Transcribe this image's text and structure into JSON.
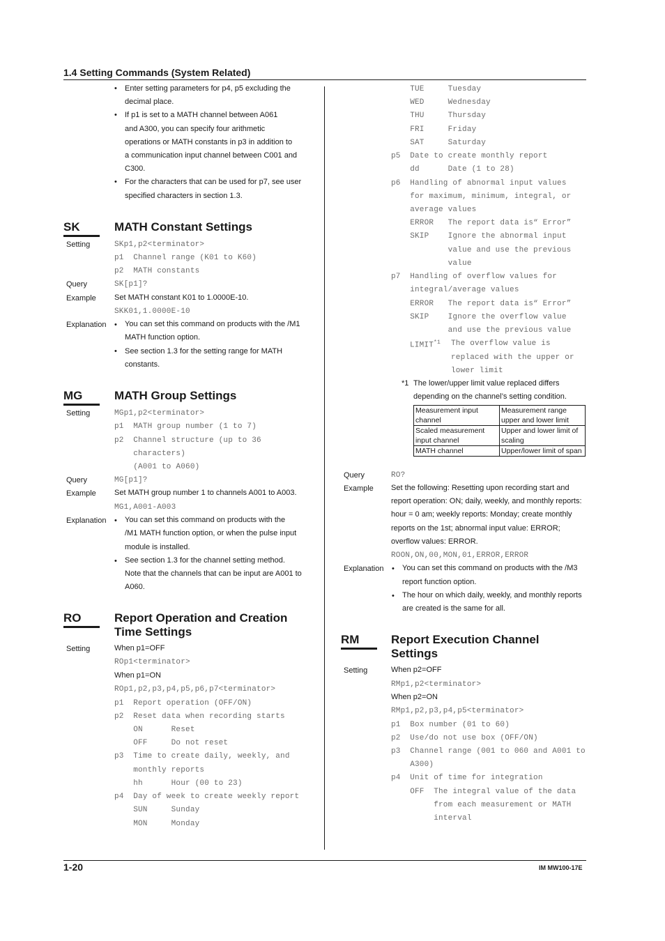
{
  "header": {
    "section": "1.4  Setting Commands (System Related)"
  },
  "footer": {
    "page": "1-20",
    "doc_id": "IM MW100-17E"
  },
  "intro_bullets": [
    [
      "Enter setting parameters for p4, p5 excluding the",
      "decimal place."
    ],
    [
      "If p1 is set to a MATH channel between A061",
      "and A300, you can specify four arithmetic",
      "operations or MATH constants in p3 in addition to",
      "a communication input channel between C001 and",
      "C300."
    ],
    [
      "For the characters that can be used for p7, see user",
      "specified characters in section 1.3."
    ]
  ],
  "labels": {
    "setting": "Setting",
    "query": "Query",
    "example": "Example",
    "explanation": "Explanation"
  },
  "sk": {
    "code": "SK",
    "title": "MATH Constant Settings",
    "setting": [
      "SKp1,p2<terminator>",
      "p1  Channel range (K01 to K60)",
      "p2  MATH constants"
    ],
    "query": "SK[p1]?",
    "example_text": "Set MATH constant K01 to 1.0000E-10.",
    "example_code": "SKK01,1.0000E-10",
    "explanation": [
      [
        "You can set this command on products with the /M1",
        "MATH function option."
      ],
      [
        "See section 1.3 for the setting range for MATH",
        "constants."
      ]
    ]
  },
  "mg": {
    "code": "MG",
    "title": "MATH Group Settings",
    "setting": [
      "MGp1,p2<terminator>",
      "p1  MATH group number (1 to 7)",
      "p2  Channel structure (up to 36",
      "    characters)",
      "    (A001 to A060)"
    ],
    "query": "MG[p1]?",
    "example_text": "Set MATH group number 1 to channels A001 to A003.",
    "example_code": "MG1,A001-A003",
    "explanation": [
      [
        "You can set this command on products with the",
        "/M1 MATH function option, or when the pulse input",
        "module is installed."
      ],
      [
        "See section 1.3 for the channel setting method.",
        "Note that the channels that can be input are A001 to",
        "A060."
      ]
    ]
  },
  "ro": {
    "code": "RO",
    "title": "Report Operation and Creation Time Settings",
    "when_off": "When p1=OFF",
    "cmd_off": "ROp1<terminator>",
    "when_on": "When p1=ON",
    "cmd_on": "ROp1,p2,p3,p4,p5,p6,p7<terminator>",
    "params_left": [
      "p1  Report operation (OFF/ON)",
      "p2  Reset data when recording starts",
      "    ON      Reset",
      "    OFF     Do not reset",
      "p3  Time to create daily, weekly, and",
      "    monthly reports",
      "    hh      Hour (00 to 23)",
      "p4  Day of week to create weekly report",
      "    SUN     Sunday",
      "    MON     Monday"
    ],
    "params_right": [
      "    TUE     Tuesday",
      "    WED     Wednesday",
      "    THU     Thursday",
      "    FRI     Friday",
      "    SAT     Saturday",
      "p5  Date to create monthly report",
      "    dd      Date (1 to 28)",
      "p6  Handling of abnormal input values",
      "    for maximum, minimum, integral, or",
      "    average values",
      "    ERROR   The report data is“ Error”",
      "    SKIP    Ignore the abnormal input",
      "            value and use the previous",
      "            value",
      "p7  Handling of overflow values for",
      "    integral/average values",
      "    ERROR   The report data is“ Error”",
      "    SKIP    Ignore the overflow value",
      "            and use the previous value"
    ],
    "limit_key": "LIMIT",
    "limit_sup": "*1",
    "limit_lines": [
      "The overflow value is",
      "replaced with the upper or",
      "lower limit"
    ],
    "footnote_mark": "*1",
    "footnote": [
      "The lower/upper limit value replaced differs",
      "depending on the channel’s setting condition."
    ],
    "limit_table": [
      [
        "Measurement input channel",
        "Measurement range upper and lower limit"
      ],
      [
        "Scaled measurement input channel",
        "Upper and lower limit of scaling"
      ],
      [
        "MATH channel",
        "Upper/lower limit of span"
      ]
    ],
    "query": "RO?",
    "example_text": [
      "Set the following: Resetting upon recording start and",
      "report operation: ON; daily, weekly, and monthly reports:",
      "hour = 0 am; weekly reports: Monday; create monthly",
      "reports on the 1st; abnormal input value: ERROR;",
      "overflow values: ERROR."
    ],
    "example_code": "ROON,ON,00,MON,01,ERROR,ERROR",
    "explanation": [
      [
        "You can set this command on products with the /M3",
        "report function option."
      ],
      [
        "The hour on which daily, weekly, and monthly reports",
        "are created is the same for all."
      ]
    ]
  },
  "rm": {
    "code": "RM",
    "title": "Report Execution Channel Settings",
    "when_off": "When p2=OFF",
    "cmd_off": "RMp1,p2<terminator>",
    "when_on": "When p2=ON",
    "cmd_on": "RMp1,p2,p3,p4,p5<terminator>",
    "params": [
      "p1  Box number (01 to 60)",
      "p2  Use/do not use box (OFF/ON)",
      "p3  Channel range (001 to 060 and A001 to",
      "    A300)",
      "p4  Unit of time for integration",
      "    OFF  The integral value of the data",
      "         from each measurement or MATH",
      "         interval"
    ]
  }
}
